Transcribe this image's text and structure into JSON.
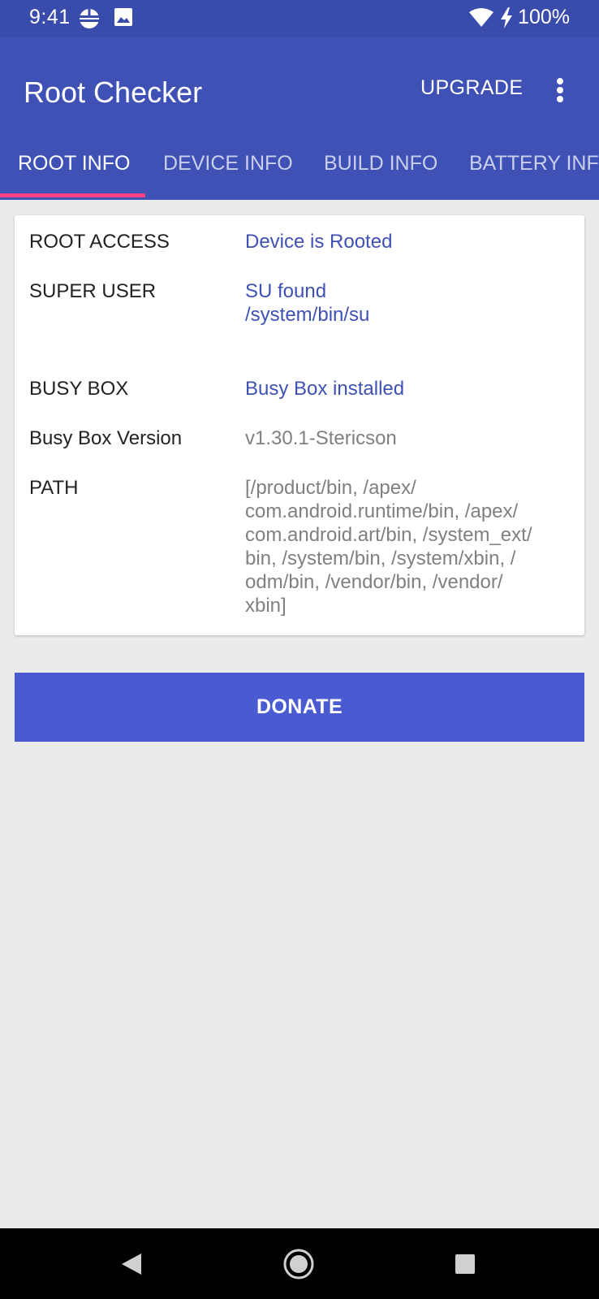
{
  "status_bar": {
    "time": "9:41",
    "battery": "100%",
    "icons": [
      "data-saver-icon",
      "image-icon",
      "wifi-icon",
      "charging-icon"
    ]
  },
  "app_bar": {
    "title": "Root Checker",
    "upgrade_label": "UPGRADE",
    "overflow_icon": "more-vert-icon"
  },
  "tabs": [
    {
      "label": "ROOT INFO",
      "active": true
    },
    {
      "label": "DEVICE INFO",
      "active": false
    },
    {
      "label": "BUILD INFO",
      "active": false
    },
    {
      "label": "BATTERY INFO",
      "active": false
    }
  ],
  "root_info": {
    "root_access": {
      "label": "ROOT ACCESS",
      "value": "Device is Rooted"
    },
    "super_user": {
      "label": "SUPER USER",
      "value": "SU found\n/system/bin/su"
    },
    "busy_box": {
      "label": "BUSY BOX",
      "value": "Busy Box installed"
    },
    "busy_box_version": {
      "label": "Busy Box Version",
      "value": "v1.30.1-Stericson"
    },
    "path": {
      "label": "PATH",
      "value": "[/product/bin, /apex/\ncom.android.runtime/bin, /apex/\ncom.android.art/bin, /system_ext/\nbin, /system/bin, /system/xbin, /\nodm/bin, /vendor/bin, /vendor/\nxbin]"
    }
  },
  "donate_label": "DONATE",
  "colors": {
    "app_bar": "#3f51b5",
    "status_bar": "#3a4cab",
    "tab_indicator": "#ff4081",
    "donate_button": "#4a5bd1",
    "value_blue": "#3f51b5",
    "value_gray": "#808080",
    "background": "#ebebeb"
  },
  "nav_bar": {
    "icons": [
      "back-icon",
      "home-icon",
      "recents-icon"
    ]
  }
}
